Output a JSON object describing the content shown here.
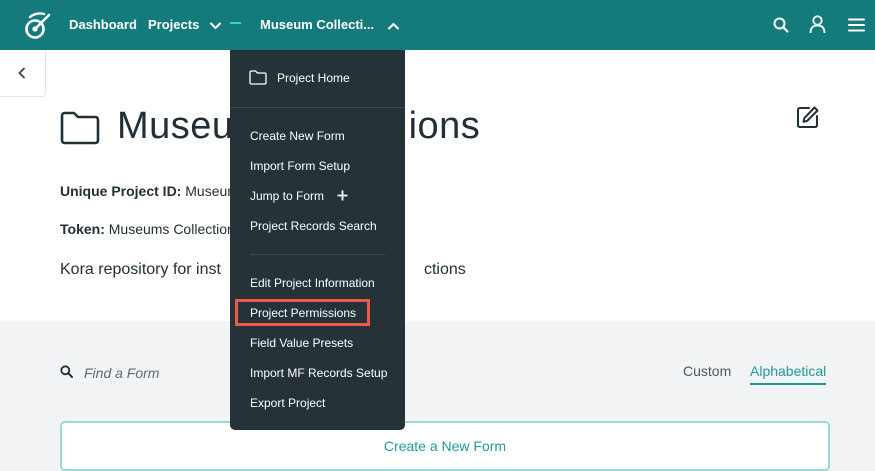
{
  "nav": {
    "dashboard": "Dashboard",
    "projects": "Projects",
    "current_project": "Museum Collecti..."
  },
  "project": {
    "title_visible_left": "Museu",
    "title_visible_right": "ions",
    "id_label": "Unique Project ID:",
    "id_value": "Museum",
    "token_label": "Token:",
    "token_value": "Museums Collection",
    "description_left": "Kora repository for inst",
    "description_right": "ctions"
  },
  "dropdown": {
    "project_home": "Project Home",
    "create_form": "Create New Form",
    "import_form": "Import Form Setup",
    "jump_to_form": "Jump to Form",
    "records_search": "Project Records Search",
    "edit_info": "Edit Project Information",
    "permissions": "Project Permissions",
    "presets": "Field Value Presets",
    "import_mf": "Import MF Records Setup",
    "export": "Export Project"
  },
  "forms": {
    "search_placeholder": "Find a Form",
    "sort_custom": "Custom",
    "sort_alpha": "Alphabetical",
    "create_button": "Create a New Form"
  },
  "colors": {
    "header": "#157a7c",
    "accent": "#1d9b97",
    "dropdown": "#253338",
    "highlight": "#ea5a4a"
  }
}
